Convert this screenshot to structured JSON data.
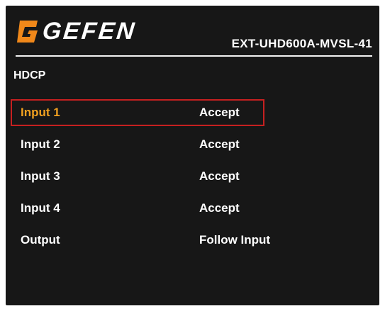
{
  "colors": {
    "background": "#171717",
    "text": "#ffffff",
    "selected_label": "#f0a020",
    "selection_border": "#c62020",
    "logo_orange": "#f0881a"
  },
  "header": {
    "logo_text": "GEFEN",
    "model": "EXT-UHD600A-MVSL-41"
  },
  "menu": {
    "title": "HDCP",
    "selected_index": 0,
    "rows": [
      {
        "label": "Input 1",
        "value": "Accept"
      },
      {
        "label": "Input 2",
        "value": "Accept"
      },
      {
        "label": "Input 3",
        "value": "Accept"
      },
      {
        "label": "Input 4",
        "value": "Accept"
      },
      {
        "label": "Output",
        "value": "Follow Input"
      }
    ]
  }
}
